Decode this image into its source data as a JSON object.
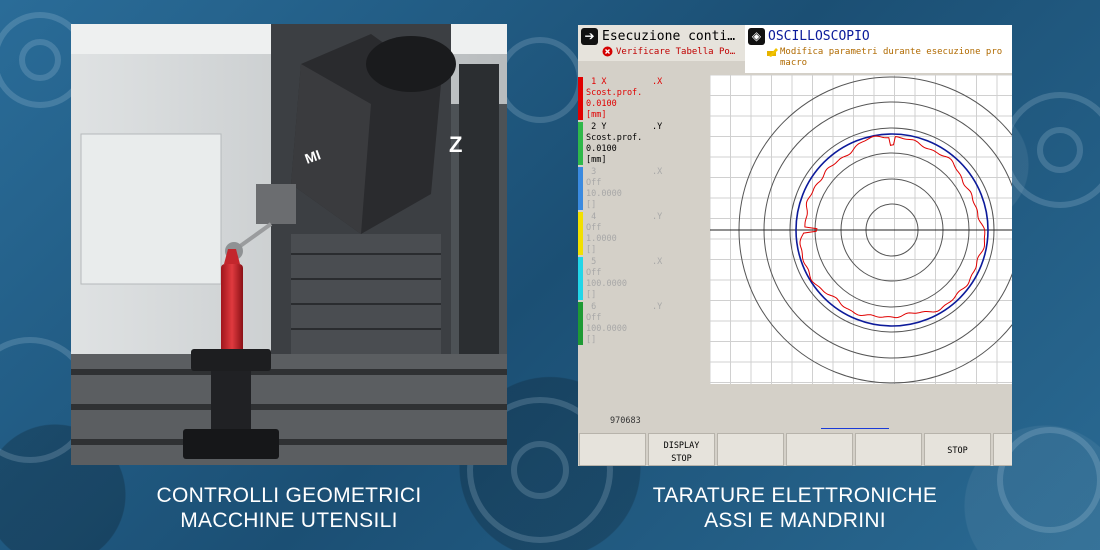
{
  "left_panel": {
    "caption_line1": "CONTROLLI GEOMETRICI",
    "caption_line2": "MACCHINE UTENSILI"
  },
  "right_panel": {
    "caption_line1": "TARATURE ELETTRONICHE",
    "caption_line2": "ASSI E MANDRINI"
  },
  "photo": {
    "machine_label": "MI",
    "axis_label": "Z"
  },
  "scope": {
    "tab1_title": "Esecuzione conti…",
    "tab1_sub": "Verificare Tabella Po…",
    "tab2_title": "OSCILLOSCOPIO",
    "tab2_sub1": "Modifica parametri durante esecuzione pro",
    "tab2_sub2": "macro",
    "channels": [
      {
        "num": "1",
        "axis": "X",
        "axis_letter": ".X",
        "label": "Scost.prof.",
        "value": "0.0100",
        "unit": "[mm]",
        "color": "#e00000",
        "bar": "#e00000"
      },
      {
        "num": "2",
        "axis": "Y",
        "axis_letter": ".Y",
        "label": "Scost.prof.",
        "value": "0.0100",
        "unit": "[mm]",
        "color": "#000000",
        "bar": "#2fb84a"
      },
      {
        "num": "3",
        "axis": "",
        "axis_letter": ".X",
        "label": "Off",
        "value": "10.0000",
        "unit": "[]",
        "color": "#a8a8a8",
        "bar": "#3a8ae0"
      },
      {
        "num": "4",
        "axis": "",
        "axis_letter": ".Y",
        "label": "Off",
        "value": "1.0000",
        "unit": "[]",
        "color": "#a8a8a8",
        "bar": "#f2e000"
      },
      {
        "num": "5",
        "axis": "",
        "axis_letter": ".X",
        "label": "Off",
        "value": "100.0000",
        "unit": "[]",
        "color": "#a8a8a8",
        "bar": "#22d6e8"
      },
      {
        "num": "6",
        "axis": "",
        "axis_letter": ".Y",
        "label": "Off",
        "value": "100.0000",
        "unit": "[]",
        "color": "#a8a8a8",
        "bar": "#1e9a34"
      }
    ],
    "counter": "970683",
    "softkeys": [
      "",
      "DISPLAY\nSTOP",
      "",
      "",
      "",
      "STOP",
      ""
    ]
  }
}
